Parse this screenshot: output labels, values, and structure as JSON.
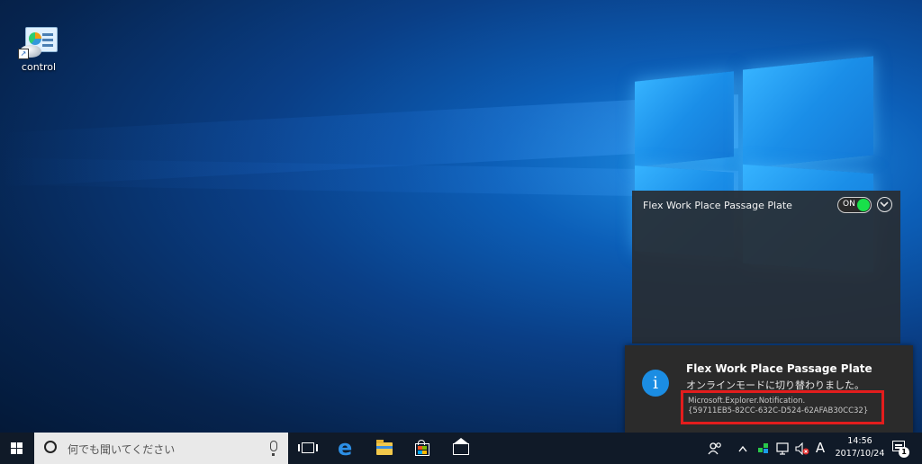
{
  "desktop": {
    "icons": [
      {
        "label": "control",
        "icon": "control-panel-icon"
      }
    ]
  },
  "action_center": {
    "title": "Flex Work Place Passage Plate",
    "toggle_label": "ON",
    "toggle_state": "on",
    "toggle_color": "#18e04a"
  },
  "toast": {
    "icon": "info-icon",
    "title": "Flex Work Place Passage Plate",
    "message": "オンラインモードに切り替わりました。",
    "source_line1": "Microsoft.Explorer.Notification.",
    "source_line2": "{59711EB5-82CC-632C-D524-62AFAB30CC32}",
    "highlight_color": "#e31d1d"
  },
  "taskbar": {
    "search_placeholder": "何でも聞いてください",
    "pinned": [
      "task-view-icon",
      "edge-icon",
      "file-explorer-icon",
      "store-icon",
      "mail-icon"
    ],
    "ime_indicator": "A",
    "time": "14:56",
    "date": "2017/10/24",
    "notification_count": "1"
  }
}
